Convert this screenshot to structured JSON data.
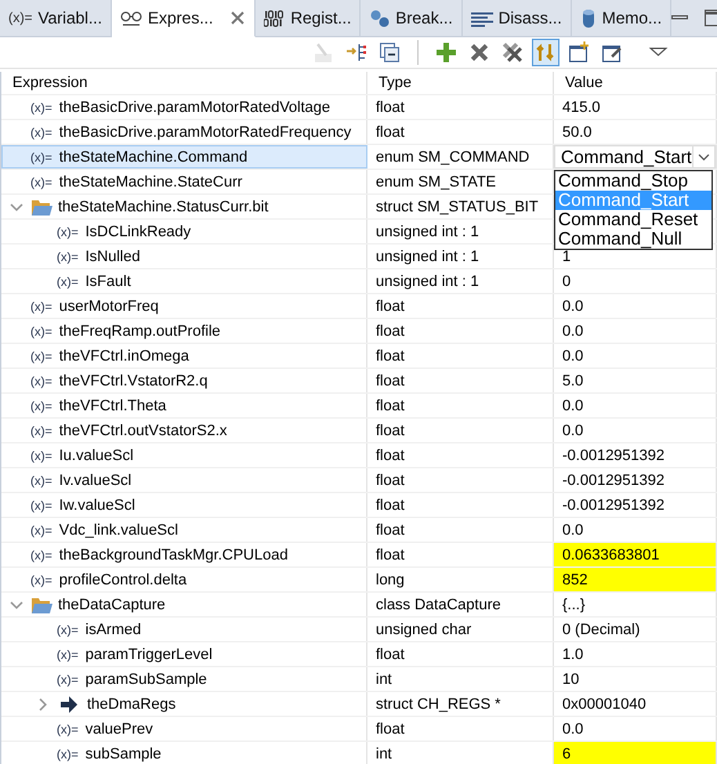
{
  "tabs": [
    {
      "icon": "(x)=",
      "label": "Variabl...",
      "selected": false
    },
    {
      "label": "Expres...",
      "selected": true,
      "kind": "expressions",
      "closable": true
    },
    {
      "label": "Regist...",
      "selected": false,
      "kind": "registers"
    },
    {
      "label": "Break...",
      "selected": false,
      "kind": "breakpoints"
    },
    {
      "label": "Disass...",
      "selected": false,
      "kind": "disassembly"
    },
    {
      "label": "Memo...",
      "selected": false,
      "kind": "memory"
    }
  ],
  "toolbar": [
    {
      "kind": "edit",
      "disabled": true,
      "pressed": false
    },
    {
      "kind": "link",
      "disabled": false,
      "pressed": false
    },
    {
      "kind": "collapse",
      "disabled": false,
      "pressed": false
    },
    {
      "kind": "separator"
    },
    {
      "kind": "add",
      "disabled": false,
      "pressed": false
    },
    {
      "kind": "remove",
      "disabled": false,
      "pressed": false
    },
    {
      "kind": "remove-all",
      "disabled": false,
      "pressed": false
    },
    {
      "kind": "refresh",
      "disabled": false,
      "pressed": true
    },
    {
      "kind": "new-window",
      "disabled": false,
      "pressed": false
    },
    {
      "kind": "pin",
      "disabled": false,
      "pressed": false
    },
    {
      "kind": "menu",
      "disabled": false,
      "pressed": false
    }
  ],
  "tree": {
    "columns": [
      "Expression",
      "Type",
      "Value"
    ],
    "rows": [
      {
        "kind": "variable",
        "icon": "(x)=",
        "expression": "theBasicDrive.paramMotorRatedVoltage",
        "type": "float",
        "value": "415.0",
        "selected": false,
        "changed": false
      },
      {
        "kind": "variable",
        "icon": "(x)=",
        "expression": "theBasicDrive.paramMotorRatedFrequency",
        "type": "float",
        "value": "50.0",
        "selected": false,
        "changed": false
      },
      {
        "kind": "variable",
        "icon": "(x)=",
        "expression": "theStateMachine.Command",
        "type": "enum SM_COMMAND",
        "selected": true,
        "editor": {
          "value": "Command_Start",
          "options": [
            {
              "label": "Command_Stop",
              "selected": false
            },
            {
              "label": "Command_Start",
              "selected": true
            },
            {
              "label": "Command_Reset",
              "selected": false
            },
            {
              "label": "Command_Null",
              "selected": false
            }
          ]
        }
      },
      {
        "kind": "variable",
        "icon": "(x)=",
        "expression": "theStateMachine.StateCurr",
        "type": "enum SM_STATE",
        "selected": false
      },
      {
        "kind": "struct",
        "expression": "theStateMachine.StatusCurr.bit",
        "type": "struct SM_STATUS_BIT",
        "selected": false,
        "expanded": true,
        "children": [
          {
            "kind": "variable",
            "icon": "(x)=",
            "expression": "IsDCLinkReady",
            "type": "unsigned int : 1",
            "selected": false
          },
          {
            "kind": "variable",
            "icon": "(x)=",
            "expression": "IsNulled",
            "type": "unsigned int : 1",
            "value": "1",
            "selected": false,
            "changed": false
          },
          {
            "kind": "variable",
            "icon": "(x)=",
            "expression": "IsFault",
            "type": "unsigned int : 1",
            "value": "0",
            "selected": false,
            "changed": false
          }
        ]
      },
      {
        "kind": "variable",
        "icon": "(x)=",
        "expression": "userMotorFreq",
        "type": "float",
        "value": "0.0",
        "selected": false,
        "changed": false
      },
      {
        "kind": "variable",
        "icon": "(x)=",
        "expression": "theFreqRamp.outProfile",
        "type": "float",
        "value": "0.0",
        "selected": false,
        "changed": false
      },
      {
        "kind": "variable",
        "icon": "(x)=",
        "expression": "theVFCtrl.inOmega",
        "type": "float",
        "value": "0.0",
        "selected": false,
        "changed": false
      },
      {
        "kind": "variable",
        "icon": "(x)=",
        "expression": "theVFCtrl.VstatorR2.q",
        "type": "float",
        "value": "5.0",
        "selected": false,
        "changed": false
      },
      {
        "kind": "variable",
        "icon": "(x)=",
        "expression": "theVFCtrl.Theta",
        "type": "float",
        "value": "0.0",
        "selected": false,
        "changed": false
      },
      {
        "kind": "variable",
        "icon": "(x)=",
        "expression": "theVFCtrl.outVstatorS2.x",
        "type": "float",
        "value": "0.0",
        "selected": false,
        "changed": false
      },
      {
        "kind": "variable",
        "icon": "(x)=",
        "expression": "Iu.valueScl",
        "type": "float",
        "value": "-0.0012951392",
        "selected": false,
        "changed": false
      },
      {
        "kind": "variable",
        "icon": "(x)=",
        "expression": "Iv.valueScl",
        "type": "float",
        "value": "-0.0012951392",
        "selected": false,
        "changed": false
      },
      {
        "kind": "variable",
        "icon": "(x)=",
        "expression": "Iw.valueScl",
        "type": "float",
        "value": "-0.0012951392",
        "selected": false,
        "changed": false
      },
      {
        "kind": "variable",
        "icon": "(x)=",
        "expression": "Vdc_link.valueScl",
        "type": "float",
        "value": "0.0",
        "selected": false,
        "changed": false
      },
      {
        "kind": "variable",
        "icon": "(x)=",
        "expression": "theBackgroundTaskMgr.CPULoad",
        "type": "float",
        "value": "0.0633683801",
        "selected": false,
        "changed": true
      },
      {
        "kind": "variable",
        "icon": "(x)=",
        "expression": "profileControl.delta",
        "type": "long",
        "value": "852",
        "selected": false,
        "changed": true
      },
      {
        "kind": "struct",
        "expression": "theDataCapture",
        "type": "class DataCapture",
        "value": "{...}",
        "selected": false,
        "changed": false,
        "expanded": true,
        "children": [
          {
            "kind": "variable",
            "icon": "(x)=",
            "expression": "isArmed",
            "type": "unsigned char",
            "value": "0 (Decimal)",
            "selected": false,
            "changed": false
          },
          {
            "kind": "variable",
            "icon": "(x)=",
            "expression": "paramTriggerLevel",
            "type": "float",
            "value": "1.0",
            "selected": false,
            "changed": false
          },
          {
            "kind": "variable",
            "icon": "(x)=",
            "expression": "paramSubSample",
            "type": "int",
            "value": "10",
            "selected": false,
            "changed": false
          },
          {
            "kind": "pointer",
            "expression": "theDmaRegs",
            "type": "struct CH_REGS *",
            "value": "0x00001040",
            "selected": false,
            "changed": false,
            "expanded": false
          },
          {
            "kind": "variable",
            "icon": "(x)=",
            "expression": "valuePrev",
            "type": "float",
            "value": "0.0",
            "selected": false,
            "changed": false
          },
          {
            "kind": "variable",
            "icon": "(x)=",
            "expression": "subSample",
            "type": "int",
            "value": "6",
            "selected": false,
            "changed": true
          }
        ]
      }
    ]
  }
}
